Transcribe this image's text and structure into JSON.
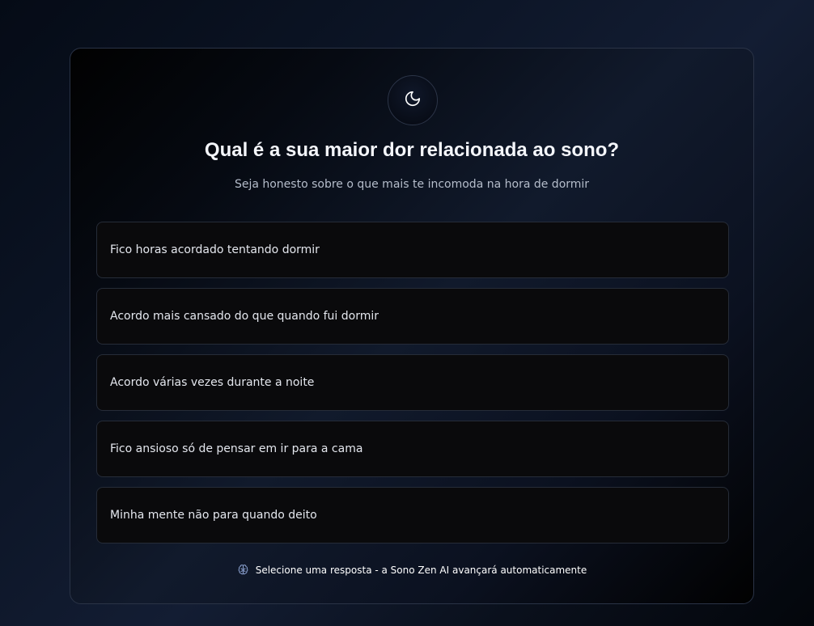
{
  "quiz": {
    "icon": "moon-icon",
    "title": "Qual é a sua maior dor relacionada ao sono?",
    "subtitle": "Seja honesto sobre o que mais te incomoda na hora de dormir",
    "options": [
      {
        "label": "Fico horas acordado tentando dormir"
      },
      {
        "label": "Acordo mais cansado do que quando fui dormir"
      },
      {
        "label": "Acordo várias vezes durante a noite"
      },
      {
        "label": "Fico ansioso só de pensar em ir para a cama"
      },
      {
        "label": "Minha mente não para quando deito"
      }
    ],
    "hint": {
      "icon": "brain-icon",
      "text": "Selecione uma resposta - a Sono Zen AI avançará automaticamente"
    }
  },
  "colors": {
    "background": "#0d1628",
    "card_border": "#2a3346",
    "option_background": "#0a0a0c",
    "option_border": "#262c38",
    "title": "#f4f6fb",
    "subtitle": "#b5bdcb",
    "hint_icon": "#8fa6d6"
  }
}
